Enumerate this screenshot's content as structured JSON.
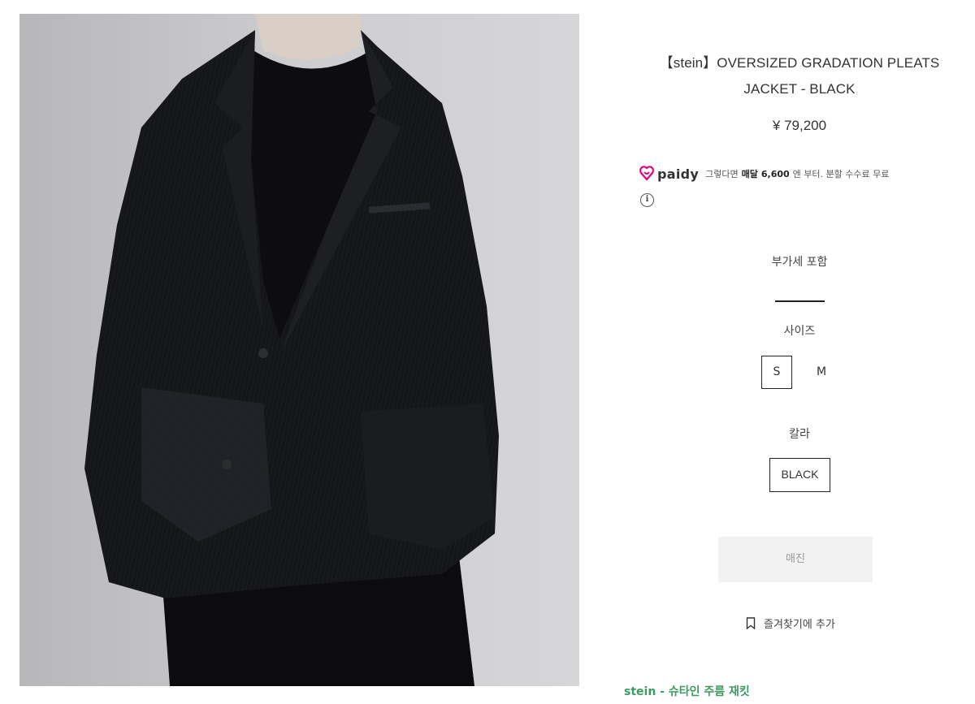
{
  "product": {
    "title_line1": "【stein】OVERSIZED GRADATION PLEATS",
    "title_line2": "JACKET - BLACK",
    "price": "¥ 79,200"
  },
  "paidy": {
    "brand": "paidy",
    "text_before": "그렇다면",
    "text_bold": "매달",
    "amount": "6,600",
    "text_after": "엔 부터. 분할 수수료 무료"
  },
  "tax_note": "부가세 포함",
  "size": {
    "label": "사이즈",
    "options": [
      "S",
      "M"
    ],
    "selected": "S"
  },
  "color": {
    "label": "칼라",
    "options": [
      "BLACK"
    ],
    "selected": "BLACK"
  },
  "buttons": {
    "soldout": "매진",
    "wishlist": "즐겨찾기에 추가"
  },
  "brand_link": "stein - 슈타인 주름 재킷",
  "colors": {
    "accent_green": "#3d9a63",
    "paidy_pink": "#e6007e"
  },
  "icons": {
    "paidy": "paidy-logo-icon",
    "info": "info-icon",
    "bookmark": "bookmark-icon"
  }
}
